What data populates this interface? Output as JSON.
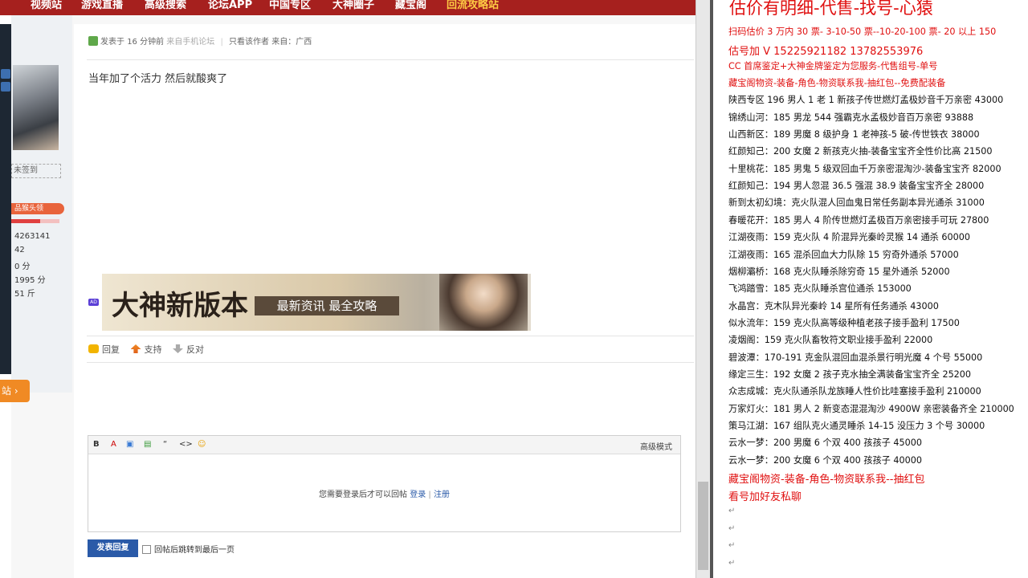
{
  "nav": {
    "items": [
      "视频站",
      "游戏直播",
      "高级搜索",
      "论坛APP",
      "中国专区",
      "大神圈子",
      "藏宝阁",
      "回流攻略站"
    ]
  },
  "profile": {
    "sign_status": "未签到",
    "medal": "品猴头领",
    "stats": [
      "4263141",
      "42",
      "0 分",
      "1995 分",
      "51 斤"
    ],
    "side_tab": "站 ›"
  },
  "post": {
    "posted_prefix": "发表于",
    "posted_time": "16 分钟前",
    "source": "来自手机论坛",
    "only_author": "只看该作者",
    "from": "来自：广西",
    "body": "当年加了个活力 然后就酸爽了",
    "ad_label": "AD",
    "banner_title": "大神新版本",
    "banner_sub": "最新资讯 最全攻略",
    "actions": {
      "reply": "回复",
      "support": "支持",
      "oppose": "反对"
    }
  },
  "editor": {
    "tools": [
      "B",
      "A",
      "▣",
      "▤",
      "“",
      "<>",
      "☺"
    ],
    "advanced": "高级模式",
    "login_prompt": "您需要登录后才可以回帖",
    "login": "登录",
    "sep": "|",
    "register": "注册",
    "submit": "发表回复",
    "jump_label": "回帖后跳转到最后一页"
  },
  "doc": {
    "title": "估价有明细-代售-找号-心猿",
    "lines": [
      {
        "text": "扫码估价 3 万内 30 票- 3-10-50 票--10-20-100 票- 20 以上 150",
        "color": "red"
      },
      {
        "text": "估号加 V 15225921182    13782553976",
        "color": "red",
        "size": "big"
      },
      {
        "text": "CC 首席鉴定+大神金牌鉴定为您服务-代售组号-单号",
        "color": "red"
      },
      {
        "text": "藏宝阁物资-装备-角色-物资联系我-抽红包--免费配装备",
        "color": "red"
      },
      {
        "text": "陕西专区 196 男人 1 老 1 新孩子传世燃灯孟极妙音千万亲密 43000",
        "color": "black"
      },
      {
        "text": "锦绣山河：185 男龙 544 强霸克水孟极妙音百万亲密 93888",
        "color": "black"
      },
      {
        "text": "山西新区：189 男魔 8 级护身 1 老神孩-5 破-传世铁衣 38000",
        "color": "black"
      },
      {
        "text": "红颜知己：200 女魔 2 新孩克火抽-装备宝宝齐全性价比高 21500",
        "color": "black"
      },
      {
        "text": "十里桃花：185 男鬼 5 级双回血千万亲密混淘沙-装备宝宝齐 82000",
        "color": "black"
      },
      {
        "text": "红颜知己：194 男人忽混 36.5 强混 38.9 装备宝宝齐全 28000",
        "color": "black"
      },
      {
        "text": "新到太初幻境：克火队混人回血鬼日常任务副本异光通杀 31000",
        "color": "black"
      },
      {
        "text": "春暖花开：185 男人 4 阶传世燃灯孟极百万亲密接手可玩 27800",
        "color": "black"
      },
      {
        "text": "江湖夜雨：159 克火队 4 阶混异光秦岭灵猴 14 通杀 60000",
        "color": "black"
      },
      {
        "text": "江湖夜雨：165 混杀回血大力队除 15 穷奇外通杀 57000",
        "color": "black"
      },
      {
        "text": "烟柳灞桥：168 克火队睡杀除穷奇 15 星外通杀 52000",
        "color": "black"
      },
      {
        "text": "飞鸿踏雪：185 克火队睡杀宫位通杀 153000",
        "color": "black"
      },
      {
        "text": "水晶宫：克木队异光秦岭 14 星所有任务通杀 43000",
        "color": "black"
      },
      {
        "text": "似水流年：159 克火队高等级种植老孩子接手盈利 17500",
        "color": "black"
      },
      {
        "text": "凌烟阁：159 克火队畜牧符文职业接手盈利 22000",
        "color": "black"
      },
      {
        "text": "碧波潭：170-191 克金队混回血混杀景行明光魔 4 个号 55000",
        "color": "black"
      },
      {
        "text": "缘定三生：192 女魔 2 孩子克水抽全满装备宝宝齐全 25200",
        "color": "black"
      },
      {
        "text": "众志成城：克火队通杀队龙族睡人性价比哇塞接手盈利 210000",
        "color": "black"
      },
      {
        "text": "万家灯火：181 男人 2 新变态混混淘沙 4900W 亲密装备齐全 210000",
        "color": "black"
      },
      {
        "text": "策马江湖：167 组队克火通灵睡杀 14-15 没压力 3 个号 30000",
        "color": "black"
      },
      {
        "text": "云水一梦：200 男魔 6 个双 400 孩孩子 45000",
        "color": "black"
      },
      {
        "text": "云水一梦：200 女魔 6 个双 400 孩孩子 40000",
        "color": "black"
      },
      {
        "text": "藏宝阁物资-装备-角色-物资联系我--抽红包",
        "color": "red",
        "size": "big"
      },
      {
        "text": "看号加好友私聊",
        "color": "red",
        "size": "big"
      }
    ]
  }
}
